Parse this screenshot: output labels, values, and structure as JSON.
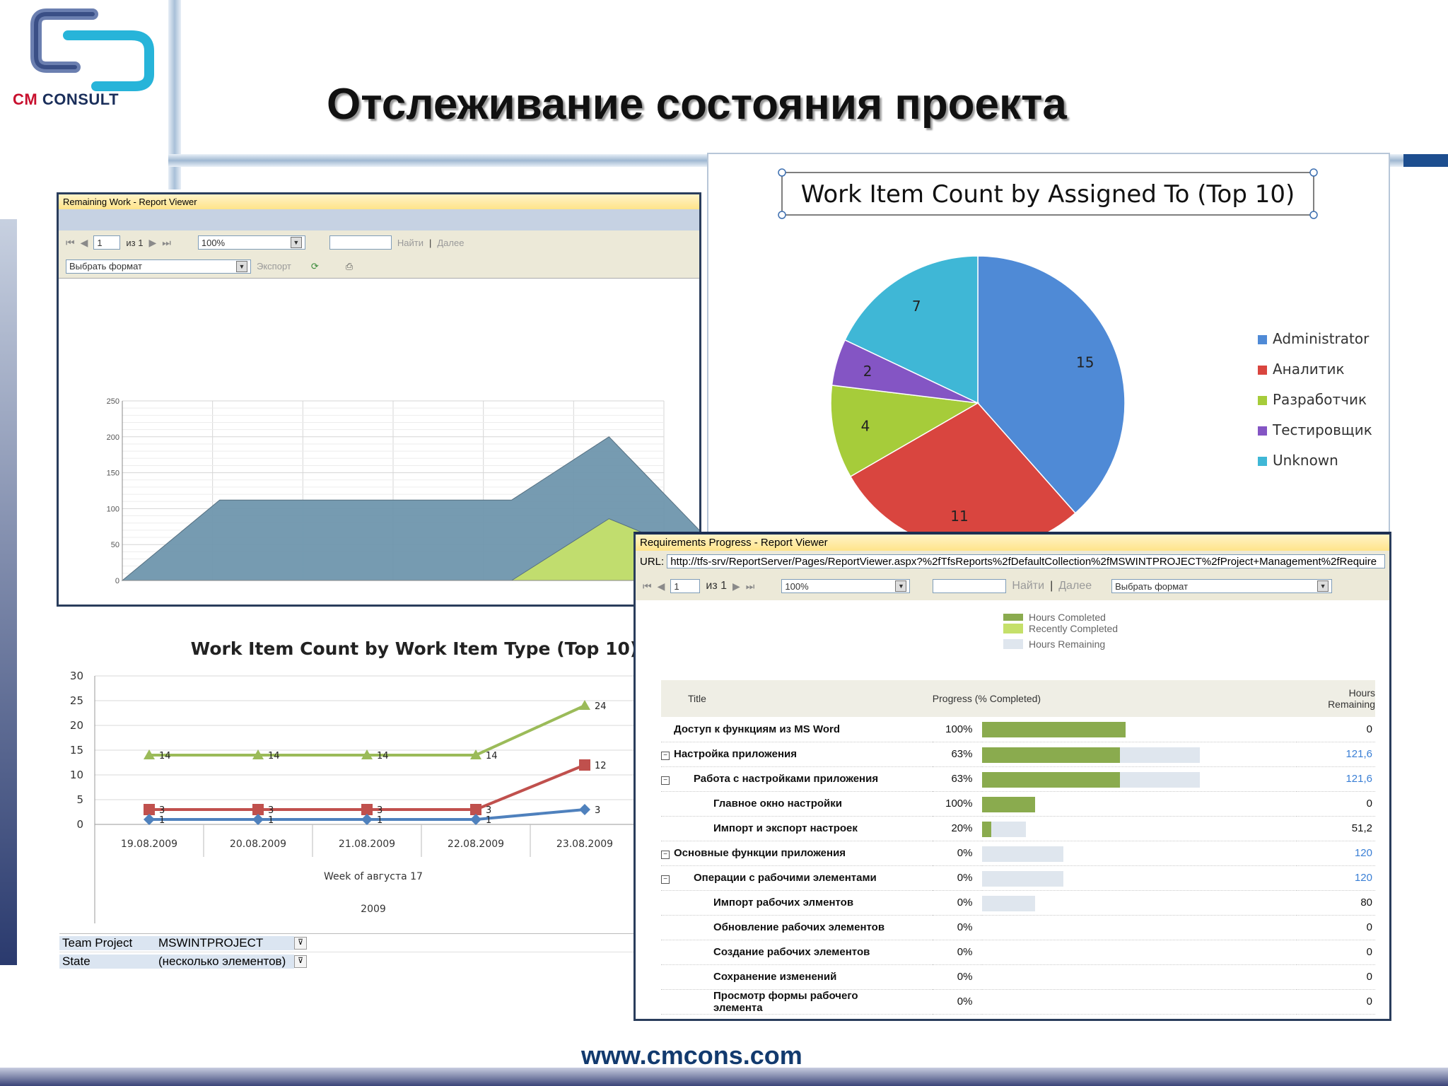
{
  "slide": {
    "title": "Отслеживание состояния проекта",
    "footer_url": "www.cmcons.com",
    "logo": {
      "cm": "CM",
      "consult": "CONSULT"
    }
  },
  "remaining_work": {
    "window_title": "Remaining Work - Report Viewer",
    "page_current": "1",
    "page_of": "из 1",
    "zoom": "100%",
    "find_label": "Найти",
    "separator": "|",
    "next_label": "Далее",
    "format_select": "Выбрать формат",
    "export_label": "Экспорт",
    "chart_data": {
      "type": "area",
      "ylim": [
        0,
        250
      ],
      "yticks": [
        0,
        50,
        100,
        150,
        200,
        250
      ],
      "x": [
        0,
        1,
        2,
        3,
        4,
        5,
        6
      ],
      "series": [
        {
          "values": [
            0,
            112,
            112,
            112,
            112,
            200,
            60
          ],
          "color": "#6f96ad"
        },
        {
          "values": [
            0,
            0,
            0,
            0,
            0,
            86,
            30
          ],
          "color": "#c5e06a"
        }
      ]
    }
  },
  "pie": {
    "chart_data": {
      "type": "pie",
      "title": "Work Item Count by Assigned To (Top 10)",
      "slices": [
        {
          "label": "Administrator",
          "value": 15,
          "color": "#4f8ad6"
        },
        {
          "label": "Аналитик",
          "value": 11,
          "color": "#d9453f"
        },
        {
          "label": "Разработчик",
          "value": 4,
          "color": "#a6cc3a"
        },
        {
          "label": "Тестировщик",
          "value": 2,
          "color": "#8455c4"
        },
        {
          "label": "Unknown",
          "value": 7,
          "color": "#3fb7d6"
        }
      ],
      "legend": "right"
    }
  },
  "wit": {
    "chart_data": {
      "type": "line",
      "title": "Work Item Count by Work Item Type (Top 10)",
      "categories": [
        "19.08.2009",
        "20.08.2009",
        "21.08.2009",
        "22.08.2009",
        "23.08.2009"
      ],
      "ylim": [
        0,
        30
      ],
      "yticks": [
        0,
        5,
        10,
        15,
        20,
        25,
        30
      ],
      "series": [
        {
          "values": [
            14,
            14,
            14,
            14,
            24
          ],
          "color": "#9bbb59",
          "marker": "triangle"
        },
        {
          "values": [
            3,
            3,
            3,
            3,
            12
          ],
          "color": "#c0504d",
          "marker": "square"
        },
        {
          "values": [
            1,
            1,
            1,
            1,
            3
          ],
          "color": "#4f81bd",
          "marker": "diamond"
        }
      ],
      "xlabel": "Week of августа 17",
      "xlabel2": "2009"
    },
    "filters": [
      {
        "name": "Team Project",
        "value": "MSWINTPROJECT"
      },
      {
        "name": "State",
        "value": "(несколько элементов)"
      }
    ]
  },
  "requirements": {
    "window_title": "Requirements Progress - Report Viewer",
    "url_label": "URL:",
    "url": "http://tfs-srv/ReportServer/Pages/ReportViewer.aspx?%2fTfsReports%2fDefaultCollection%2fMSWINTPROJECT%2fProject+Management%2fRequire",
    "page_current": "1",
    "page_of": "из 1",
    "zoom": "100%",
    "find_label": "Найти",
    "separator": "|",
    "next_label": "Далее",
    "format_select": "Выбрать формат",
    "legend": [
      "Hours Completed",
      "Recently Completed",
      "Hours Remaining"
    ],
    "legend_colors": [
      "#8aab4e",
      "#c5e06a",
      "#dfe6ee"
    ],
    "columns": {
      "title": "Title",
      "progress": "Progress (% Completed)",
      "hours": "Hours\nRemaining"
    },
    "rows": [
      {
        "title": "Доступ к функциям из MS Word",
        "pct": "100%",
        "hours": "0",
        "toggle": "",
        "indent": 0,
        "fill": 1.0,
        "track": 0.46,
        "link": false
      },
      {
        "title": "Настройка приложения",
        "pct": "63%",
        "hours": "121,6",
        "toggle": "−",
        "indent": 0,
        "fill": 0.63,
        "track": 0.7,
        "link": true
      },
      {
        "title": "Работа с настройками приложения",
        "pct": "63%",
        "hours": "121,6",
        "toggle": "−",
        "indent": 1,
        "fill": 0.63,
        "track": 0.7,
        "link": true
      },
      {
        "title": "Главное окно настройки",
        "pct": "100%",
        "hours": "0",
        "toggle": "",
        "indent": 2,
        "fill": 1.0,
        "track": 0.17,
        "link": false
      },
      {
        "title": "Импорт и экспорт настроек",
        "pct": "20%",
        "hours": "51,2",
        "toggle": "",
        "indent": 2,
        "fill": 0.2,
        "track": 0.14,
        "link": false
      },
      {
        "title": "Основные функции приложения",
        "pct": "0%",
        "hours": "120",
        "toggle": "−",
        "indent": 0,
        "fill": 0,
        "track": 0.26,
        "link": true
      },
      {
        "title": "Операции с рабочими элементами",
        "pct": "0%",
        "hours": "120",
        "toggle": "−",
        "indent": 1,
        "fill": 0,
        "track": 0.26,
        "link": true
      },
      {
        "title": "Импорт рабочих элментов",
        "pct": "0%",
        "hours": "80",
        "toggle": "",
        "indent": 2,
        "fill": 0,
        "track": 0.17,
        "link": false
      },
      {
        "title": "Обновление рабочих элементов",
        "pct": "0%",
        "hours": "0",
        "toggle": "",
        "indent": 2,
        "fill": 0,
        "track": 0,
        "link": false
      },
      {
        "title": "Создание рабочих элементов",
        "pct": "0%",
        "hours": "0",
        "toggle": "",
        "indent": 2,
        "fill": 0,
        "track": 0,
        "link": false
      },
      {
        "title": "Сохранение изменений",
        "pct": "0%",
        "hours": "0",
        "toggle": "",
        "indent": 2,
        "fill": 0,
        "track": 0,
        "link": false
      },
      {
        "title": "Просмотр формы рабочего элемента",
        "pct": "0%",
        "hours": "0",
        "toggle": "",
        "indent": 2,
        "fill": 0,
        "track": 0,
        "link": false
      }
    ]
  }
}
